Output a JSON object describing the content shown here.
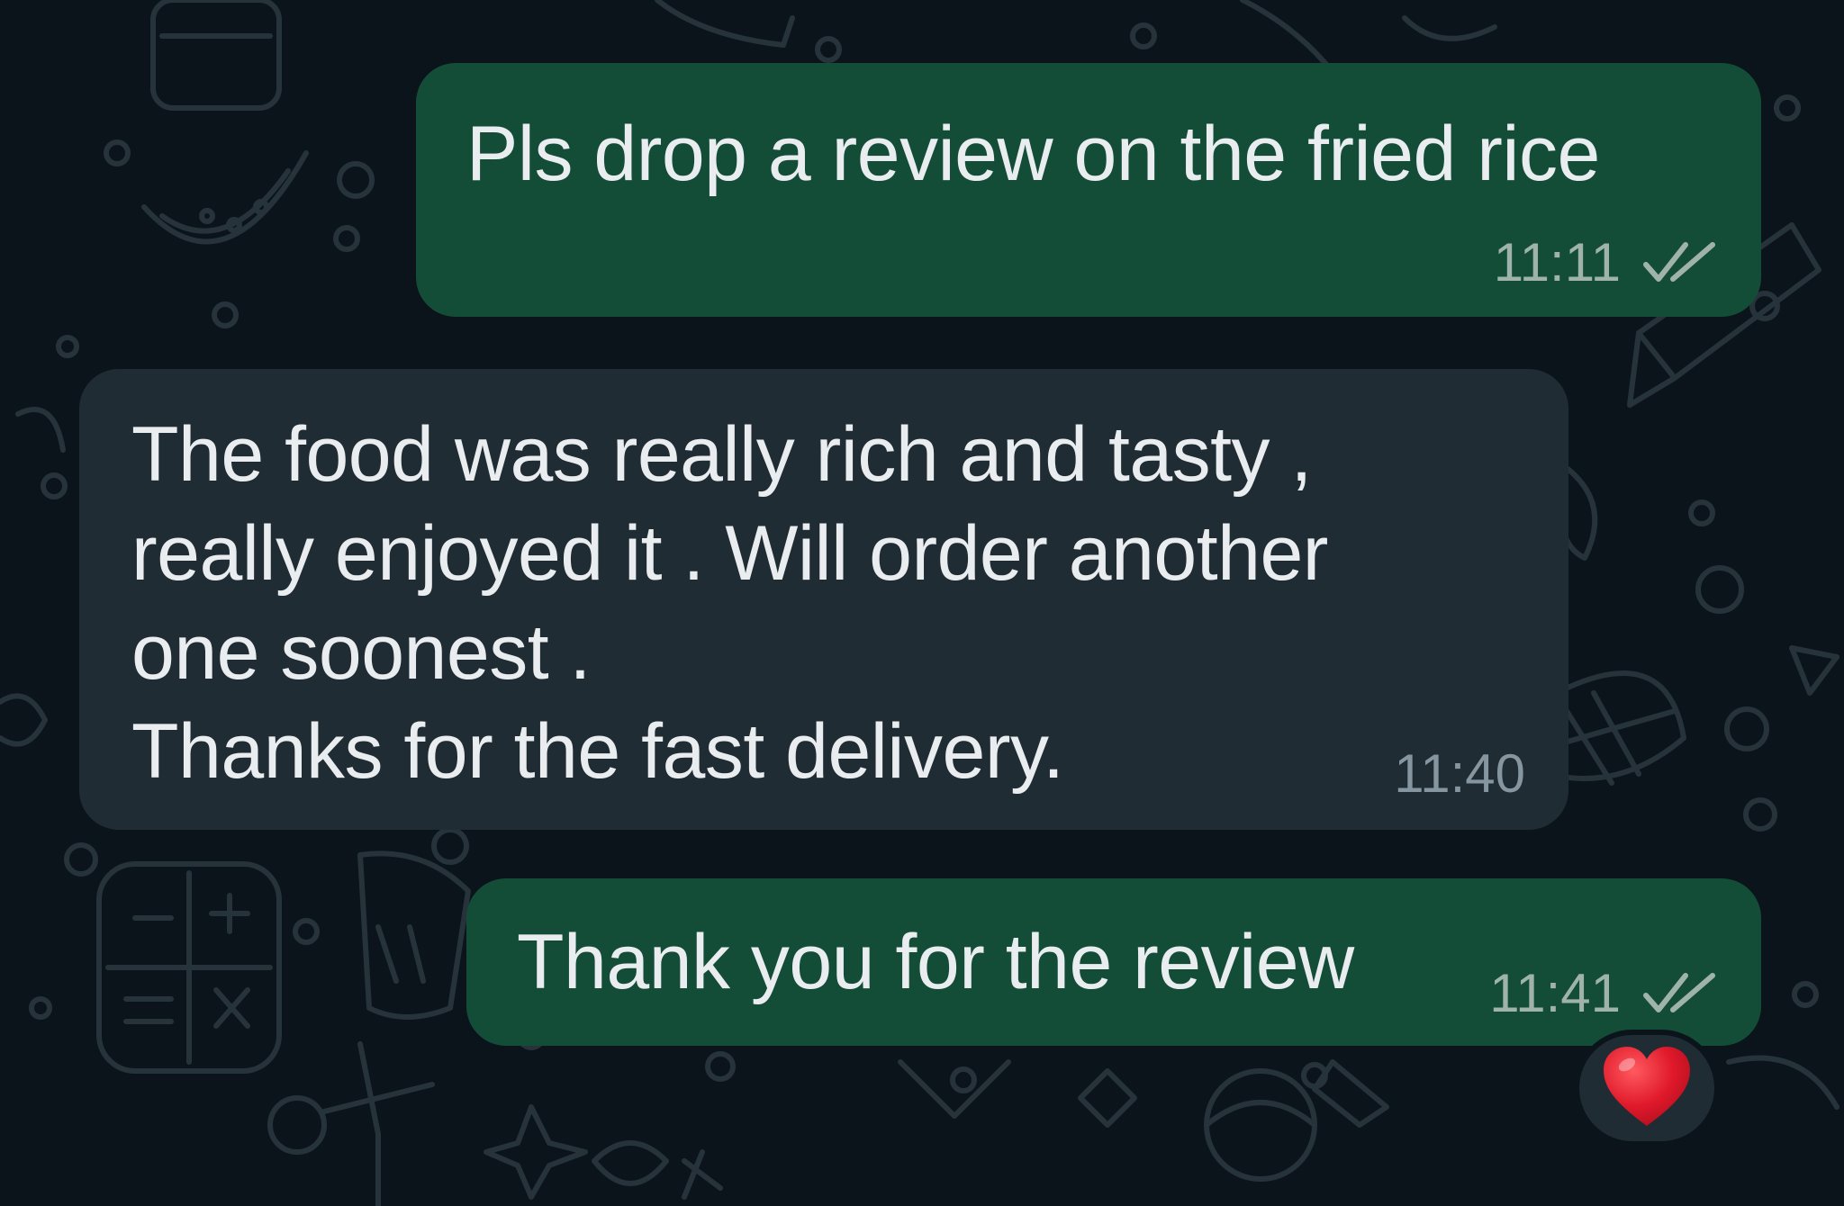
{
  "messages": [
    {
      "direction": "outgoing",
      "text": "Pls drop a review on the fried rice",
      "time": "11:11",
      "status": "read"
    },
    {
      "direction": "incoming",
      "lines": [
        "The food was really rich and tasty ,",
        "really enjoyed it . Will order another",
        "one soonest .",
        "Thanks for the fast delivery."
      ],
      "time": "11:40"
    },
    {
      "direction": "outgoing",
      "text": "Thank you for the review",
      "time": "11:41",
      "status": "read",
      "reaction": "heart"
    }
  ],
  "colors": {
    "background": "#0b141a",
    "outgoing_bubble": "#144d37",
    "incoming_bubble": "#202c33",
    "text": "#e9edef",
    "reaction_heart": "#e0192b"
  },
  "icons": {
    "read_status": "double-check-icon",
    "reaction": "heart-icon"
  }
}
